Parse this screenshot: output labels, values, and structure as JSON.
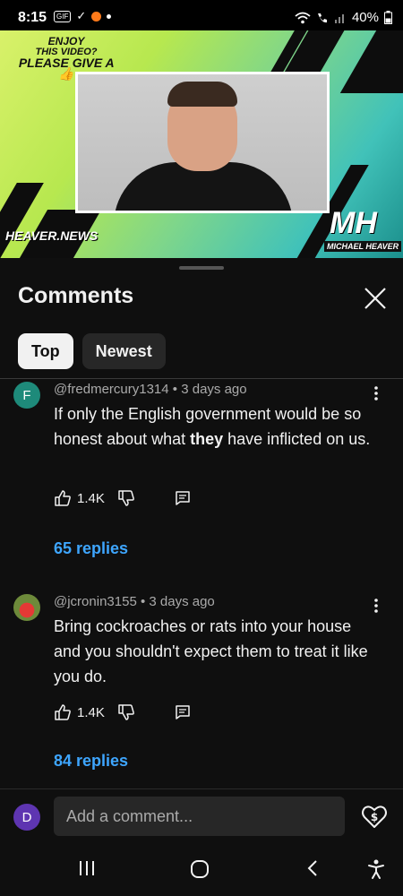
{
  "status_bar": {
    "time": "8:15",
    "battery": "40%",
    "notification_icons": [
      "rcs-icon",
      "check-icon",
      "app-badge-icon",
      "dot-icon"
    ],
    "right_icons": [
      "wifi-icon",
      "call-icon",
      "signal-icon",
      "battery-icon"
    ]
  },
  "video": {
    "promo_line1": "ENJOY",
    "promo_line2": "THIS VIDEO?",
    "promo_line3": "PLEASE GIVE A",
    "channel_tag": "HEAVER.NEWS",
    "logo": "MH",
    "logo_name": "MICHAEL HEAVER",
    "colors": {
      "bg_start": "#d9f16a",
      "bg_end": "#1b8f8c"
    }
  },
  "comments_panel": {
    "title": "Comments",
    "tabs": [
      {
        "label": "Top",
        "active": true
      },
      {
        "label": "Newest",
        "active": false
      }
    ],
    "comments": [
      {
        "avatar_letter": "F",
        "avatar_color": "#1e8a7a",
        "author": "@fredmercury1314",
        "time": "3 days ago",
        "text_before": "If only the English government would be so honest about what ",
        "text_bold": "they",
        "text_after": " have inflicted on us.",
        "likes": "1.4K",
        "replies": "65 replies"
      },
      {
        "avatar_letter": "",
        "avatar_color": "#7a8a3a",
        "author": "@jcronin3155",
        "time": "3 days ago",
        "text": "Bring cockroaches or rats into your house and you shouldn't expect them to treat it like you do.",
        "likes": "1.4K",
        "replies": "84 replies"
      }
    ]
  },
  "add_comment": {
    "avatar_letter": "D",
    "placeholder": "Add a comment..."
  },
  "colors": {
    "accent_link": "#3ea6ff",
    "background": "#0f0f0f",
    "chip_active": "#f1f1f1",
    "chip_inactive": "#272727"
  }
}
